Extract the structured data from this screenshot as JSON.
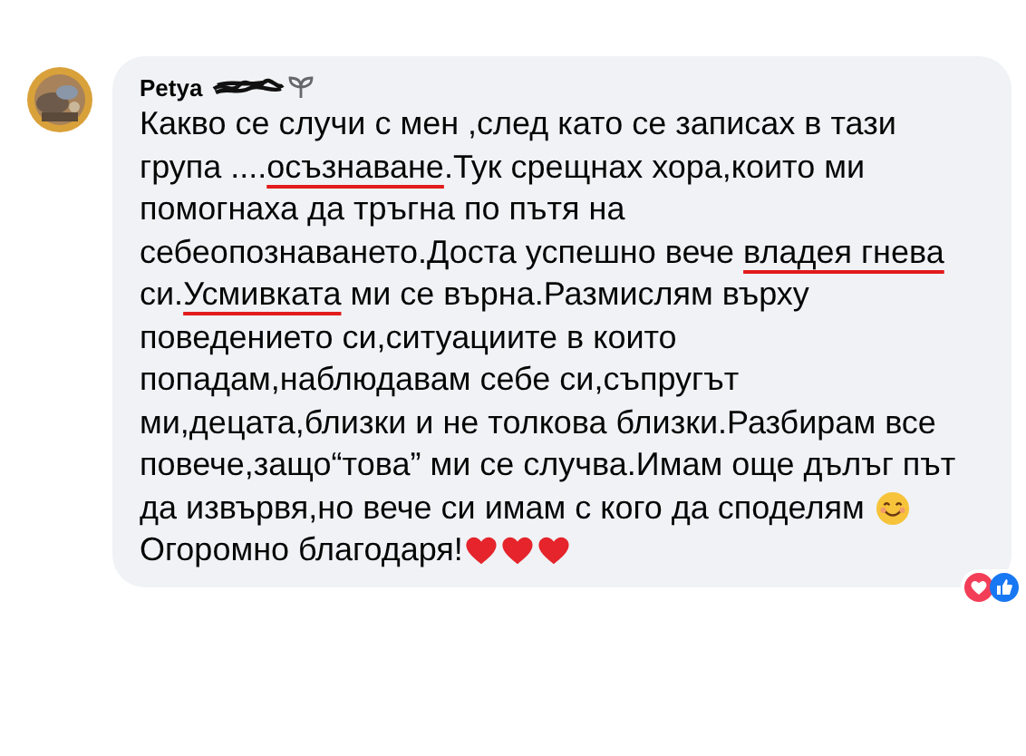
{
  "comment": {
    "author": "Petya",
    "author_name_scribbled": true,
    "lines": [
      [
        {
          "kind": "text",
          "text": "Какво се случи с мен ,след като се записах в тази",
          "underlined": false
        }
      ],
      [
        {
          "kind": "text",
          "text": "група ....",
          "underlined": false
        },
        {
          "kind": "text",
          "text": "осъзнаване",
          "underlined": true
        },
        {
          "kind": "text",
          "text": ".Тук срещнах хора,които ми",
          "underlined": false
        }
      ],
      [
        {
          "kind": "text",
          "text": "помогнаха да тръгна по пътя на",
          "underlined": false
        }
      ],
      [
        {
          "kind": "text",
          "text": "себеопознаването.Доста успешно вече ",
          "underlined": false
        },
        {
          "kind": "text",
          "text": "владея гнева",
          "underlined": true
        }
      ],
      [
        {
          "kind": "text",
          "text": "си.",
          "underlined": false
        },
        {
          "kind": "text",
          "text": "Усмивката",
          "underlined": true
        },
        {
          "kind": "text",
          "text": " ми се върна.Размислям върху",
          "underlined": false
        }
      ],
      [
        {
          "kind": "text",
          "text": "поведението си,ситуациите в които",
          "underlined": false
        }
      ],
      [
        {
          "kind": "text",
          "text": "попадам,наблюдавам себе си,съпругът",
          "underlined": false
        }
      ],
      [
        {
          "kind": "text",
          "text": "ми,децата,близки и не толкова близки.Разбирам все",
          "underlined": false
        }
      ],
      [
        {
          "kind": "text",
          "text": "повече,защо“това” ми се случва.Имам още дълъг път",
          "underlined": false
        }
      ],
      [
        {
          "kind": "text",
          "text": "да извървя,но вече си имам с кого да споделям ",
          "underlined": false
        },
        {
          "kind": "smile"
        }
      ],
      [
        {
          "kind": "text",
          "text": "Огоромно благодаря!",
          "underlined": false
        },
        {
          "kind": "heart"
        },
        {
          "kind": "heart"
        },
        {
          "kind": "heart"
        }
      ]
    ],
    "reactions": [
      {
        "kind": "love"
      },
      {
        "kind": "like"
      }
    ]
  }
}
